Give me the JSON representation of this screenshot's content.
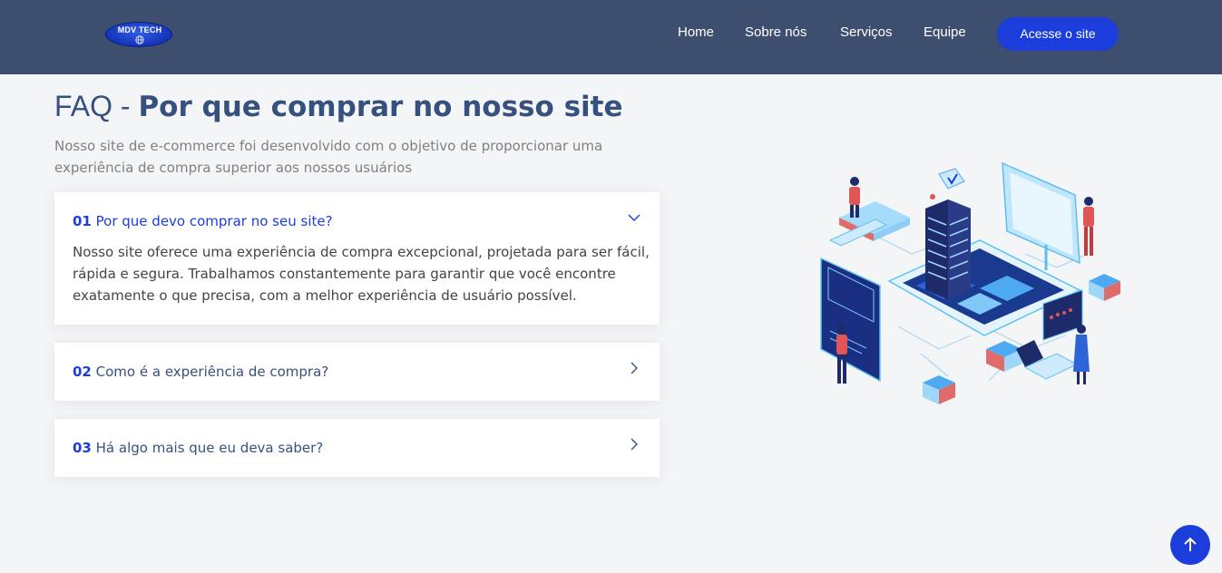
{
  "header": {
    "logo_text": "MDV TECH",
    "nav": [
      "Home",
      "Sobre nós",
      "Serviços",
      "Equipe"
    ],
    "cta_label": "Acesse o site"
  },
  "faq": {
    "title_light": "FAQ - ",
    "title_bold": "Por que comprar no nosso site",
    "subtitle": "Nosso site de e-commerce foi desenvolvido com o objetivo de proporcionar uma experiência de compra superior aos nossos usuários",
    "items": [
      {
        "num": "01",
        "question": "Por que devo comprar no seu site?",
        "answer": "Nosso site oferece uma experiência de compra excepcional, projetada para ser fácil, rápida e segura. Trabalhamos constantemente para garantir que você encontre exatamente o que precisa, com a melhor experiência de usuário possível.",
        "expanded": true
      },
      {
        "num": "02",
        "question": "Como é a experiência de compra?",
        "expanded": false
      },
      {
        "num": "03",
        "question": "Há algo mais que eu deva saber?",
        "expanded": false
      }
    ]
  },
  "icons": {
    "chevron_open": "chevron-down-icon",
    "chevron_closed": "chevron-right-icon",
    "back_to_top": "arrow-up-icon",
    "logo_globe": "globe-icon"
  },
  "colors": {
    "header_bg": "#3e4e6e",
    "accent": "#1b3ddb",
    "heading": "#37517e",
    "page_bg": "#f4f5f7"
  }
}
